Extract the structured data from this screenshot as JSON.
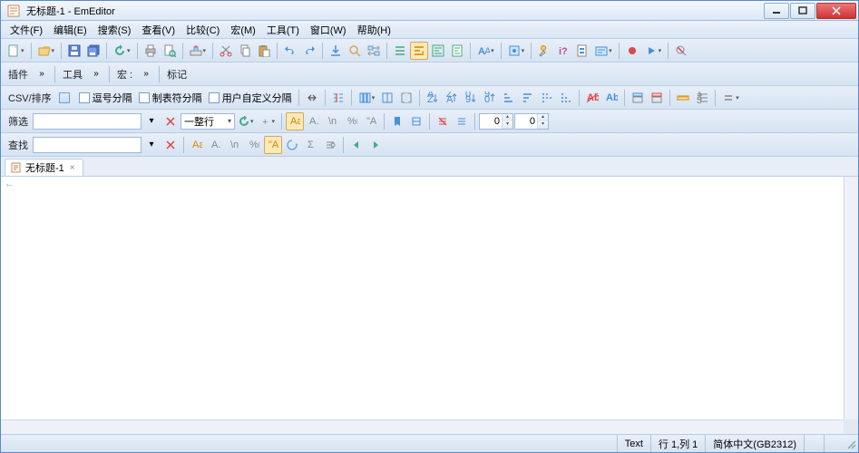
{
  "window": {
    "title": "无标题-1 - EmEditor"
  },
  "menu": {
    "file": "文件(F)",
    "edit": "编辑(E)",
    "search": "搜索(S)",
    "view": "查看(V)",
    "compare": "比较(C)",
    "macro": "宏(M)",
    "tools": "工具(T)",
    "window": "窗口(W)",
    "help": "帮助(H)"
  },
  "row2": {
    "plugin": "插件",
    "tools": "工具",
    "macro": "宏 :",
    "marker": "标记"
  },
  "csv": {
    "label": "CSV/排序",
    "comma": "逗号分隔",
    "tab": "制表符分隔",
    "user": "用户自定义分隔"
  },
  "filter": {
    "label": "筛选",
    "scope": "一整行",
    "spin1": "0",
    "spin2": "0"
  },
  "find": {
    "label": "查找"
  },
  "tab": {
    "name": "无标题-1"
  },
  "status": {
    "mode": "Text",
    "pos": "行 1,列 1",
    "encoding": "简体中文(GB2312)"
  },
  "eof": "←"
}
